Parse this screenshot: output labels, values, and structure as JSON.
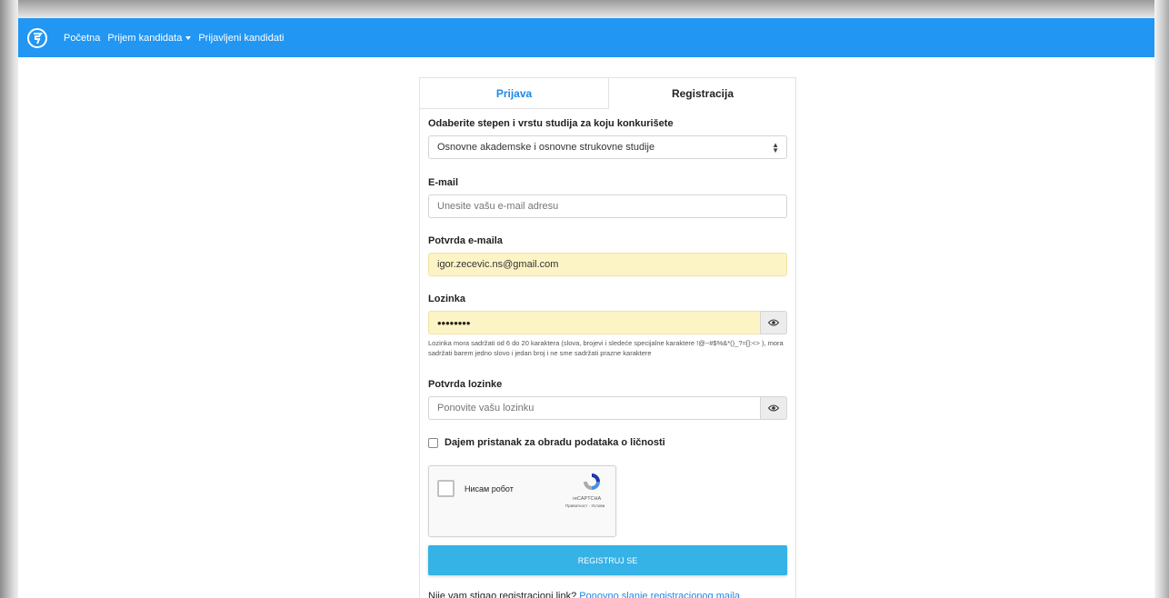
{
  "navbar": {
    "logo_icon": "university-logo-icon",
    "links": [
      "Početna",
      "Prijem kandidata",
      "Prijavljeni kandidati"
    ]
  },
  "tabs": {
    "login": "Prijava",
    "register": "Registracija"
  },
  "form": {
    "study_label": "Odaberite stepen i vrstu studija za koju konkurišete",
    "study_selected": "Osnovne akademske i osnovne strukovne studije",
    "email_label": "E-mail",
    "email_placeholder": "Unesite vašu e-mail adresu",
    "email_confirm_label": "Potvrda e-maila",
    "email_confirm_value": "igor.zecevic.ns@gmail.com",
    "password_label": "Lozinka",
    "password_value": "••••••••",
    "password_hint": "Lozinka mora sadržati od 6 do 20 karaktera (slova, brojevi i sledeće specijalne karaktere !@~#$%&*()_?=[]:<> ), mora sadržati barem jedno slovo i jedan broj i ne sme sadržati prazne karaktere",
    "password_confirm_label": "Potvrda lozinke",
    "password_confirm_placeholder": "Ponovite vašu lozinku",
    "consent_label": "Dajem pristanak za obradu podataka o ličnosti",
    "recaptcha_text": "Нисам робот",
    "recaptcha_brand": "reCAPTCHA",
    "recaptcha_terms": "Приватност - Услови",
    "register_button": "REGISTRUJ SE",
    "footer_text": "Nije vam stigao registracioni link?",
    "footer_link": "Ponovno slanje registracionog maila"
  },
  "colors": {
    "navbar": "#2196f3",
    "accent": "#1e88e5",
    "button": "#35b2e6",
    "autofill": "#fdf4c5"
  }
}
